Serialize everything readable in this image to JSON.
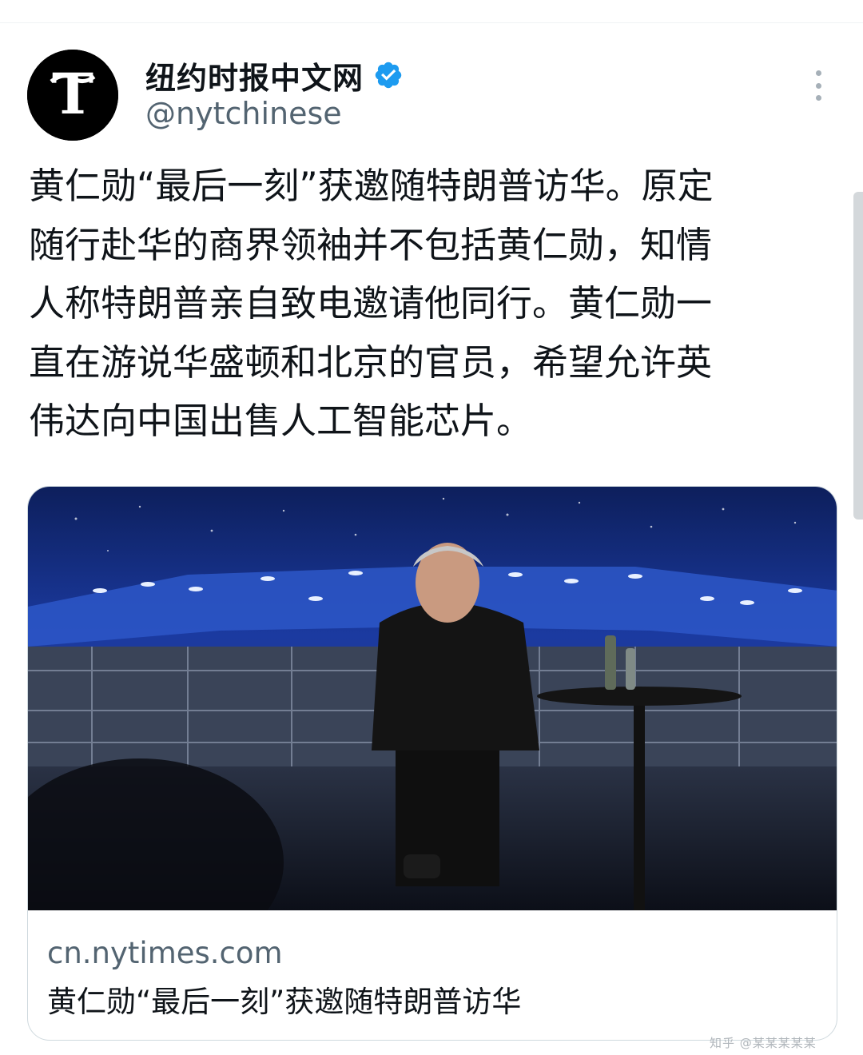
{
  "account": {
    "display_name": "纽约时报中文网",
    "handle": "@nytchinese",
    "verified": true,
    "avatar_icon": "nyt-logo-icon",
    "avatar_letter": "T"
  },
  "tweet": {
    "lines": [
      "黄仁勋“最后一刻”获邀随特朗普访华。原定",
      "随行赴华的商界领袖并不包括黄仁勋，知情",
      "人称特朗普亲自致电邀请他同行。黄仁勋一",
      "直在游说华盛顿和北京的官员，希望允许英",
      "伟达向中国出售人工智能芯片。"
    ]
  },
  "link_card": {
    "domain": "cn.nytimes.com",
    "title": "黄仁勋“最后一刻”获邀随特朗普访华"
  },
  "icons": {
    "more": "more-options-icon",
    "verified": "verified-badge-icon"
  },
  "colors": {
    "verified_blue": "#1d9bf0",
    "secondary_text": "#536471",
    "border": "#cfd9de"
  },
  "watermark": "知乎 @某某某某某"
}
